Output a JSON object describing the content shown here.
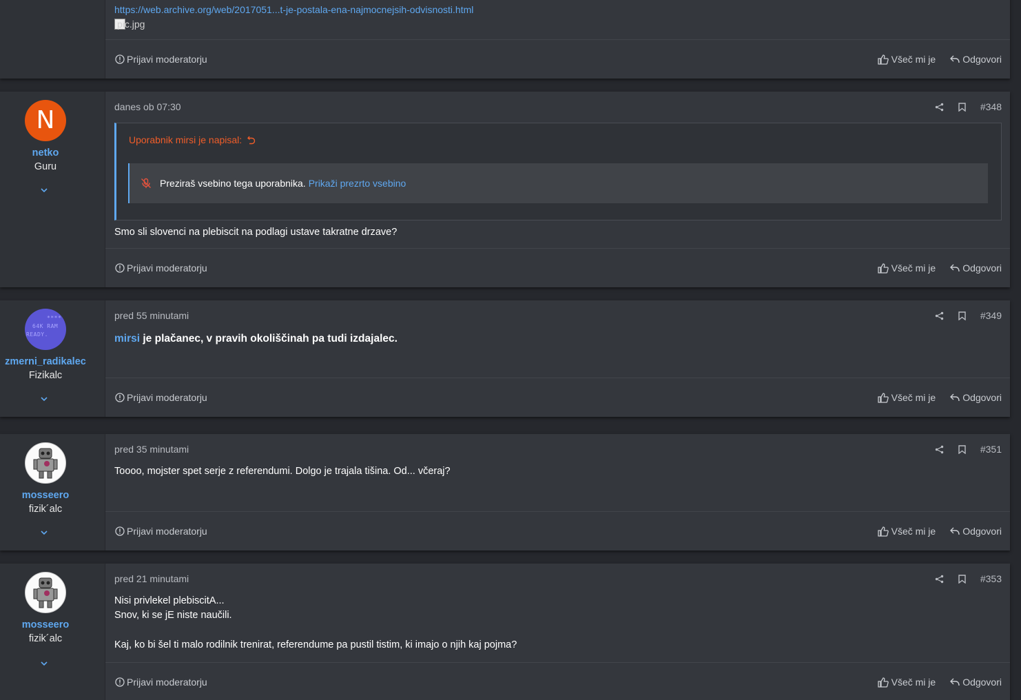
{
  "colors": {
    "accent": "#5fa8f0",
    "quote_header": "#f05d29",
    "avatar_netko": "#e8550e",
    "avatar_c64": "#5b56d6",
    "mute_icon": "#e5533d"
  },
  "footer_labels": {
    "report": "Prijavi moderatorju",
    "like": "Všeč mi je",
    "reply": "Odgovori"
  },
  "post0": {
    "link": "https://web.archive.org/web/2017051...t-je-postala-ena-najmocnejsih-odvisnosti.html",
    "image_alt": "pic.jpg"
  },
  "post348": {
    "username": "netko",
    "user_title": "Guru",
    "avatar_letter": "N",
    "date": "danes ob 07:30",
    "number": "#348",
    "quote_header": "Uporabnik mirsi je napisal:",
    "ignored_text": "Preziraš vsebino tega uporabnika.",
    "ignored_link": "Prikaži prezrto vsebino",
    "text": "Smo sli slovenci na plebiscit na podlagi ustave takratne drzave?"
  },
  "post349": {
    "username": "zmerni_radikalec",
    "user_title": "Fizikalc",
    "avatar_text_top": "****",
    "avatar_text_mid": "64K RAM",
    "avatar_text_bottom": "READY.",
    "date": "pred 55 minutami",
    "number": "#349",
    "mention": "mirsi",
    "text": " je plačanec, v pravih okoliščinah pa tudi izdajalec."
  },
  "post351": {
    "username": "mosseero",
    "user_title": "fizik´alc",
    "date": "pred 35 minutami",
    "number": "#351",
    "text": "Toooo, mojster spet serje z referendumi. Dolgo je trajala tišina. Od... včeraj?"
  },
  "post353": {
    "username": "mosseero",
    "user_title": "fizik´alc",
    "date": "pred 21 minutami",
    "number": "#353",
    "line1": "Nisi privlekel plebiscitA...",
    "line2": "Snov, ki se jE niste naučili.",
    "line3": "Kaj, ko bi šel ti malo rodilnik trenirat, referendume pa pustil tistim, ki imajo o njih kaj pojma?"
  }
}
